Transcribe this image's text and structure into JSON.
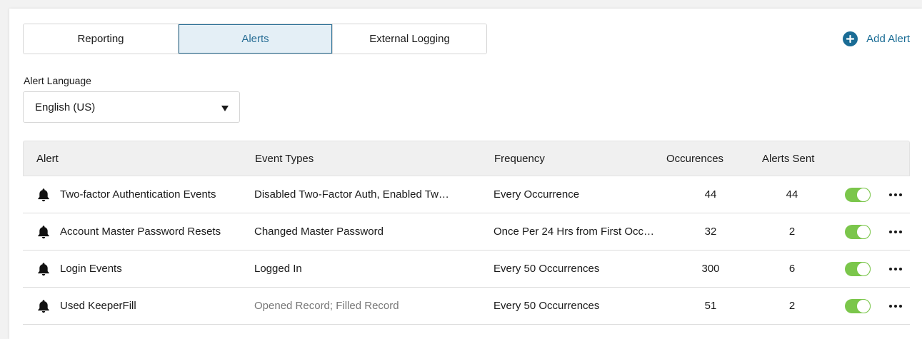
{
  "tabs": [
    {
      "label": "Reporting",
      "active": false
    },
    {
      "label": "Alerts",
      "active": true
    },
    {
      "label": "External Logging",
      "active": false
    }
  ],
  "add_alert": {
    "label": "Add Alert",
    "icon": "plus-circle-icon"
  },
  "language": {
    "label": "Alert Language",
    "value": "English (US)"
  },
  "table": {
    "headers": {
      "alert": "Alert",
      "event_types": "Event Types",
      "frequency": "Frequency",
      "occurrences": "Occurences",
      "alerts_sent": "Alerts Sent"
    },
    "rows": [
      {
        "alert": "Two-factor Authentication Events",
        "event_types": "Disabled Two-Factor Auth, Enabled Tw…",
        "event_types_muted": false,
        "frequency": "Every Occurrence",
        "occurrences": "44",
        "alerts_sent": "44",
        "enabled": true
      },
      {
        "alert": "Account Master Password Resets",
        "event_types": "Changed Master Password",
        "event_types_muted": false,
        "frequency": "Once Per 24 Hrs from First Occ…",
        "occurrences": "32",
        "alerts_sent": "2",
        "enabled": true
      },
      {
        "alert": "Login Events",
        "event_types": "Logged In",
        "event_types_muted": false,
        "frequency": "Every 50 Occurrences",
        "occurrences": "300",
        "alerts_sent": "6",
        "enabled": true
      },
      {
        "alert": "Used KeeperFill",
        "event_types": "Opened Record; Filled Record",
        "event_types_muted": true,
        "frequency": "Every 50 Occurrences",
        "occurrences": "51",
        "alerts_sent": "2",
        "enabled": true
      }
    ]
  },
  "colors": {
    "accent": "#1a6c95",
    "active_tab_bg": "#e4eff6",
    "toggle_on": "#7bc64b"
  }
}
